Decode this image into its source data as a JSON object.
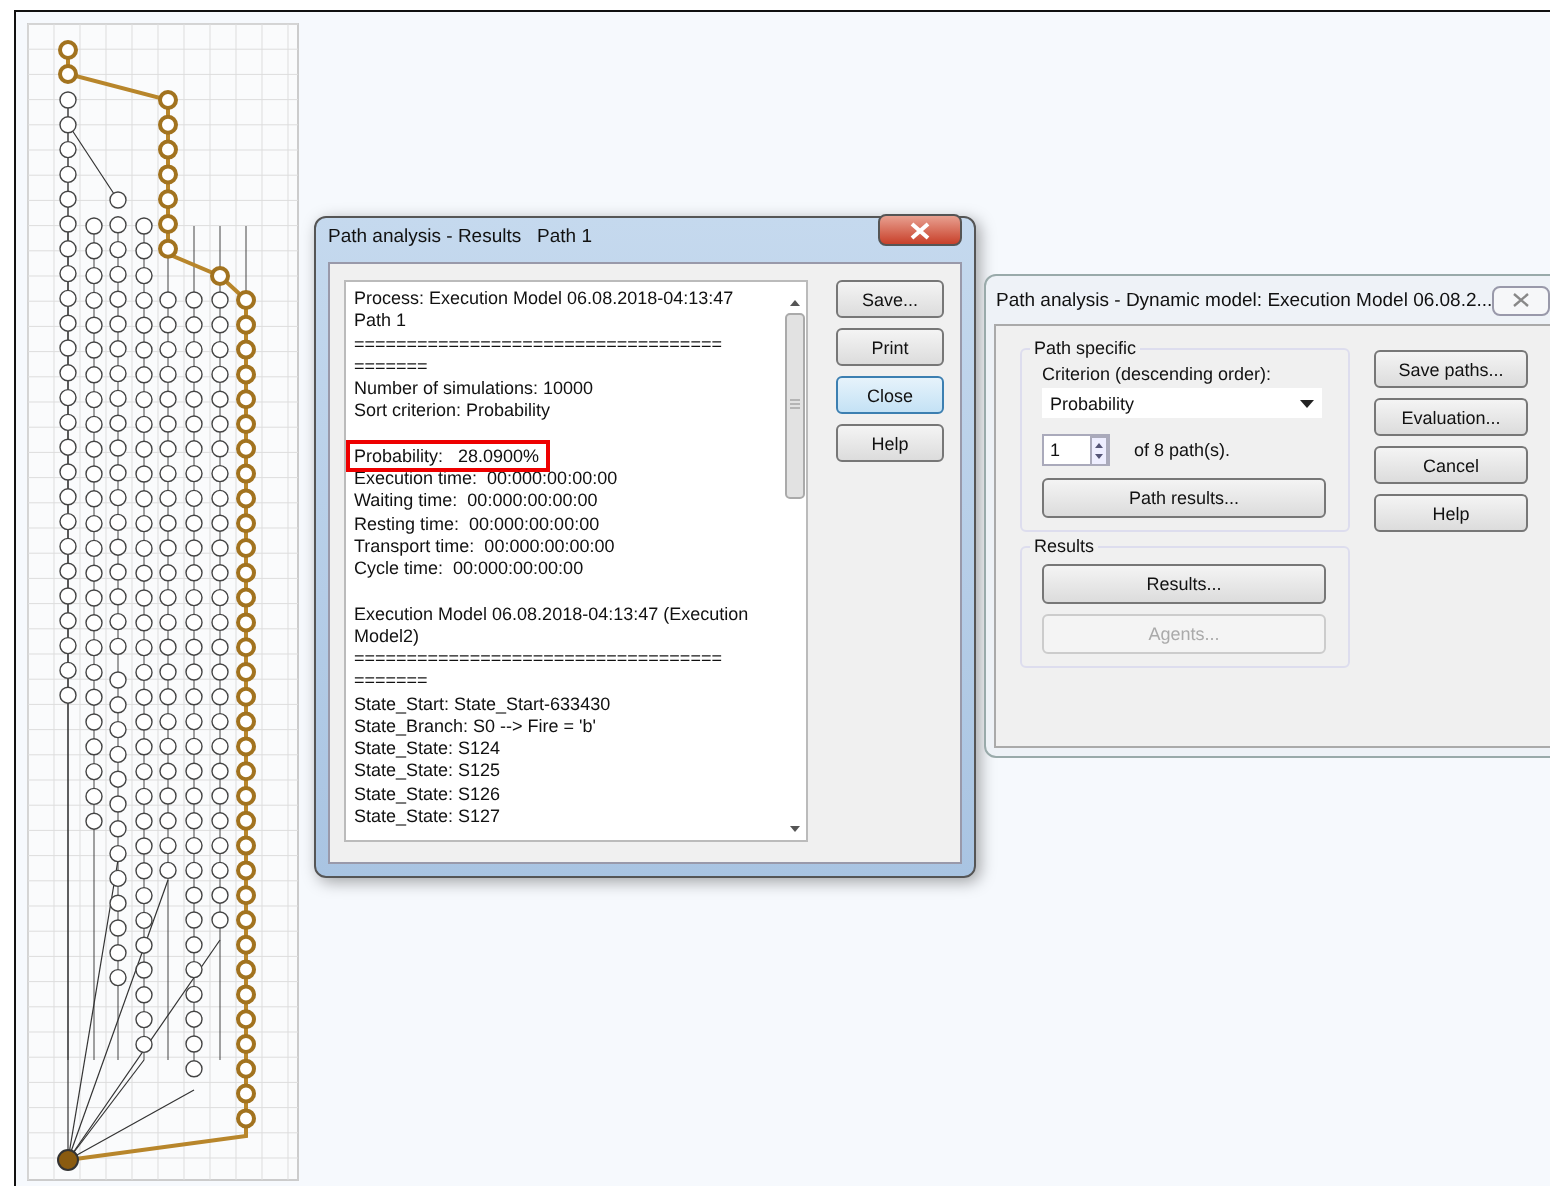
{
  "results_window": {
    "title": "Path analysis - Results   Path 1",
    "paragraphs": [
      [
        {
          "text": "Process: Execution Model 06.08.2018-04:13:47",
          "highlighted": false
        },
        {
          "text": "Path 1",
          "highlighted": false
        },
        {
          "text": "===================================",
          "highlighted": false
        },
        {
          "text": "=======",
          "highlighted": false
        },
        {
          "text": "Number of simulations: 10000",
          "highlighted": false
        },
        {
          "text": "Sort criterion: Probability",
          "highlighted": false
        }
      ],
      [
        {
          "text": "Probability:   28.0900%",
          "highlighted": true
        },
        {
          "text": "Execution time:  00:000:00:00:00",
          "highlighted": false
        },
        {
          "text": "Waiting time:  00:000:00:00:00",
          "highlighted": false
        },
        {
          "text": "Resting time:  00:000:00:00:00",
          "highlighted": false
        },
        {
          "text": "Transport time:  00:000:00:00:00",
          "highlighted": false
        },
        {
          "text": "Cycle time:  00:000:00:00:00",
          "highlighted": false
        }
      ],
      [
        {
          "text": "Execution Model 06.08.2018-04:13:47 (Execution",
          "highlighted": false
        },
        {
          "text": "Model2)",
          "highlighted": false
        },
        {
          "text": "===================================",
          "highlighted": false
        },
        {
          "text": "=======",
          "highlighted": false
        },
        {
          "text": "State_Start: State_Start-633430",
          "highlighted": false
        },
        {
          "text": "State_Branch: S0 --> Fire = 'b'",
          "highlighted": false
        },
        {
          "text": "State_State: S124",
          "highlighted": false
        },
        {
          "text": "State_State: S125",
          "highlighted": false
        },
        {
          "text": "State_State: S126",
          "highlighted": false
        },
        {
          "text": "State_State: S127",
          "highlighted": false
        }
      ]
    ],
    "buttons": [
      {
        "label": "Save...",
        "default": false
      },
      {
        "label": "Print",
        "default": false
      },
      {
        "label": "Close",
        "default": true
      },
      {
        "label": "Help",
        "default": false
      }
    ]
  },
  "dynamic_window": {
    "title": "Path analysis - Dynamic model: Execution Model 06.08.2...",
    "path_specific": {
      "title": "Path specific",
      "criterion_label": "Criterion (descending order):",
      "criterion_value": "Probability",
      "path_number": "1",
      "path_count": "of 8 path(s).",
      "button": "Path results..."
    },
    "results_group": {
      "title": "Results",
      "buttons": [
        {
          "label": "Results...",
          "disabled": false
        },
        {
          "label": "Agents...",
          "disabled": true
        }
      ]
    },
    "buttons": [
      {
        "label": "Save paths..."
      },
      {
        "label": "Evaluation..."
      },
      {
        "label": "Cancel"
      },
      {
        "label": "Help"
      }
    ]
  }
}
